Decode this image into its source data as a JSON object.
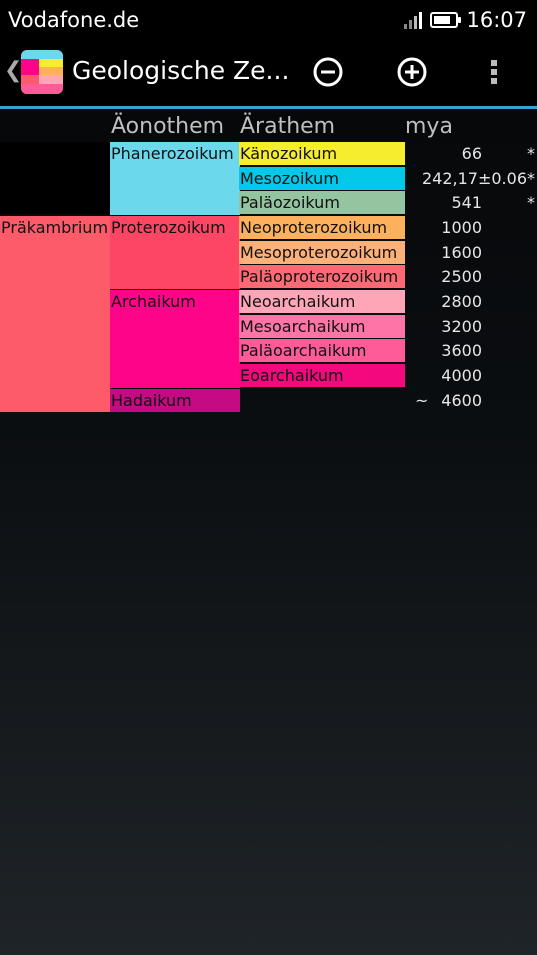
{
  "status_bar": {
    "carrier": "Vodafone.de",
    "time": "16:07"
  },
  "action_bar": {
    "title": "Geologische Ze...",
    "zoom_out_icon": "minus-circle-icon",
    "zoom_in_icon": "plus-circle-icon",
    "overflow_icon": "overflow-menu-icon"
  },
  "table": {
    "headers": {
      "aeonothem": "Äonothem",
      "arathem": "Ärathem",
      "mya": "mya"
    },
    "super_eon": {
      "label": "Präkambrium",
      "color": "#fe5b6a"
    },
    "eons": [
      {
        "label": "Phanerozoikum",
        "color": "#6cd8ec"
      },
      {
        "label": "Proterozoikum",
        "color": "#fd4566"
      },
      {
        "label": "Archaikum",
        "color": "#fe0489"
      },
      {
        "label": "Hadaikum",
        "color": "#c60a84"
      }
    ],
    "eras": [
      {
        "label": "Känozoikum",
        "color": "#f5ed2d",
        "mya": "66",
        "star": "*"
      },
      {
        "label": "Mesozoikum",
        "color": "#04c8e8",
        "mya": "242,17±0.06",
        "star": "*"
      },
      {
        "label": "Paläozoikum",
        "color": "#94c4a0",
        "mya": "541",
        "star": "*"
      },
      {
        "label": "Neoproterozoikum",
        "color": "#feb15d",
        "mya": "1000",
        "star": ""
      },
      {
        "label": "Mesoproterozoikum",
        "color": "#feb079",
        "mya": "1600",
        "star": ""
      },
      {
        "label": "Paläoproterozoikum",
        "color": "#fd6a75",
        "mya": "2500",
        "star": ""
      },
      {
        "label": "Neoarchaikum",
        "color": "#fea6b8",
        "mya": "2800",
        "star": ""
      },
      {
        "label": "Mesoarchaikum",
        "color": "#fe74a6",
        "mya": "3200",
        "star": ""
      },
      {
        "label": "Paläoarchaikum",
        "color": "#fe5b98",
        "mya": "3600",
        "star": ""
      },
      {
        "label": "Eoarchaikum",
        "color": "#f3087e",
        "mya": "4000",
        "star": ""
      }
    ],
    "hadaikum_mya": {
      "approx": "~",
      "value": "4600"
    }
  }
}
